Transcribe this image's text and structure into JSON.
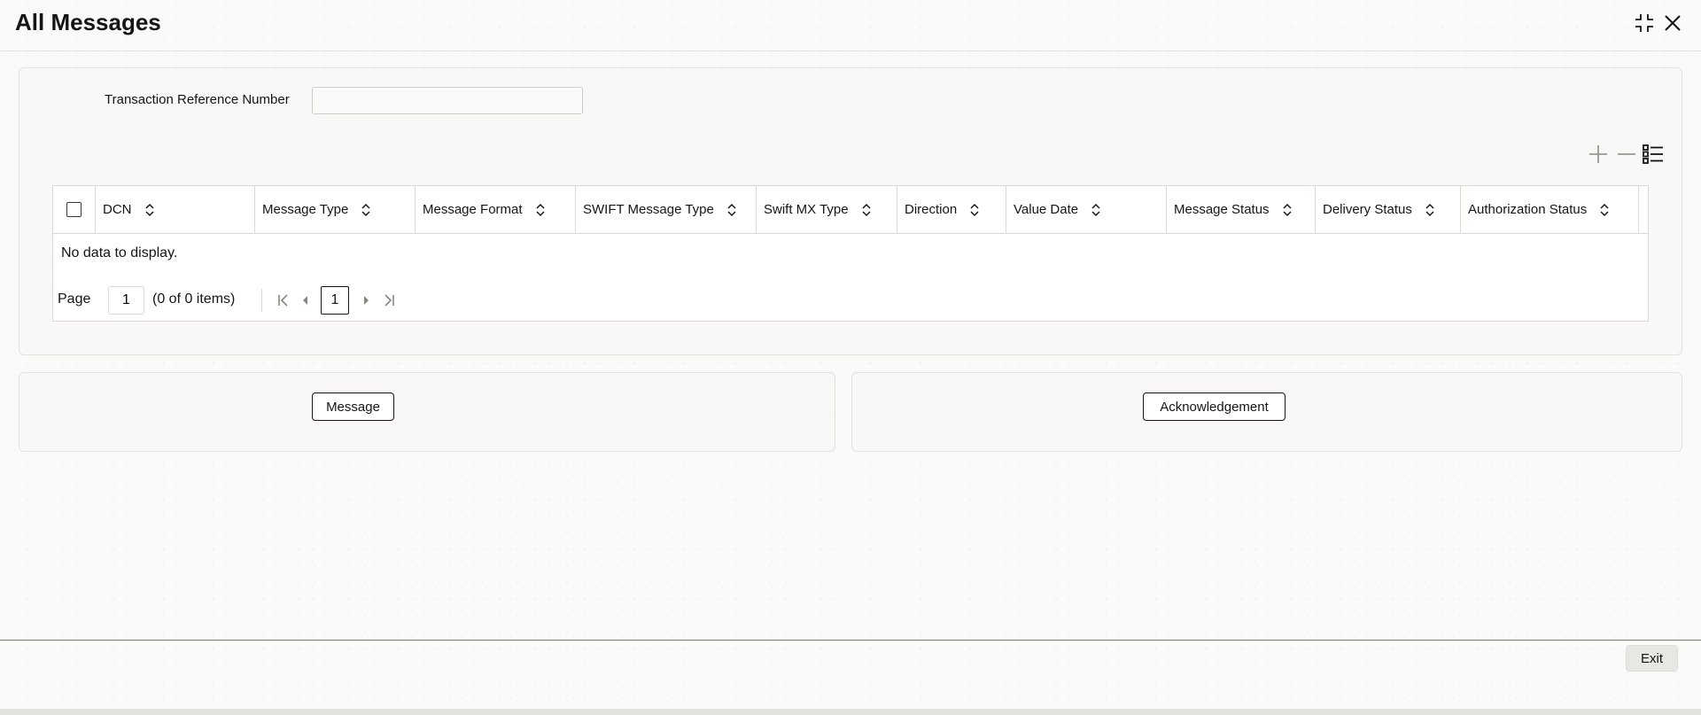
{
  "header": {
    "title": "All Messages"
  },
  "form": {
    "transaction_ref_label": "Transaction Reference Number",
    "transaction_ref_value": ""
  },
  "table": {
    "columns": [
      "DCN",
      "Message Type",
      "Message Format",
      "SWIFT Message Type",
      "Swift MX Type",
      "Direction",
      "Value Date",
      "Message Status",
      "Delivery Status",
      "Authorization Status"
    ],
    "empty_text": "No data to display."
  },
  "pagination": {
    "page_label": "Page",
    "page_value": "1",
    "items_info": "(0 of 0 items)",
    "current_page": "1"
  },
  "actions": {
    "message_label": "Message",
    "acknowledgement_label": "Acknowledgement"
  },
  "footer": {
    "exit_label": "Exit"
  },
  "icons": {
    "minimize": "minimize-icon",
    "close": "close-icon",
    "add_row": "plus-icon",
    "delete_row": "minus-icon",
    "column_list": "list-icon",
    "sort": "sort-icon",
    "first_page": "first-page-icon",
    "prev_page": "prev-page-icon",
    "next_page": "next-page-icon",
    "last_page": "last-page-icon"
  },
  "colors": {
    "text": "#161513",
    "border": "#dcd9d4",
    "background": "#fbfaf8"
  }
}
